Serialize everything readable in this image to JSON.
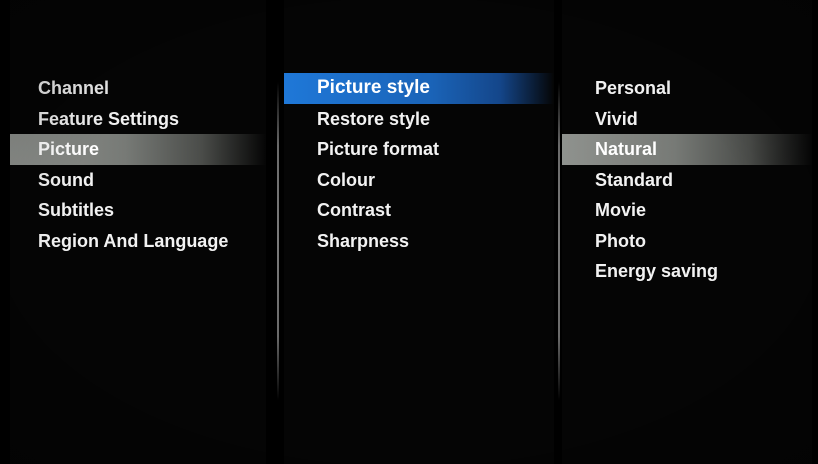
{
  "menu": {
    "level1": {
      "items": [
        {
          "label": "Channel"
        },
        {
          "label": "Feature Settings"
        },
        {
          "label": "Picture"
        },
        {
          "label": "Sound"
        },
        {
          "label": "Subtitles"
        },
        {
          "label": "Region And Language"
        }
      ],
      "selected": "Picture"
    },
    "level2": {
      "items": [
        {
          "label": "Picture style"
        },
        {
          "label": "Restore style"
        },
        {
          "label": "Picture format"
        },
        {
          "label": "Colour"
        },
        {
          "label": "Contrast"
        },
        {
          "label": "Sharpness"
        }
      ],
      "focused": "Picture style"
    },
    "level3": {
      "items": [
        {
          "label": "Personal"
        },
        {
          "label": "Vivid"
        },
        {
          "label": "Natural"
        },
        {
          "label": "Standard"
        },
        {
          "label": "Movie"
        },
        {
          "label": "Photo"
        },
        {
          "label": "Energy saving"
        }
      ],
      "selected": "Natural"
    }
  },
  "colors": {
    "background": "#000000",
    "text": "#f2f2f2",
    "focus_highlight": "#1f78d8",
    "selection_highlight": "#8f928e",
    "divider": "#7a7a7a"
  }
}
